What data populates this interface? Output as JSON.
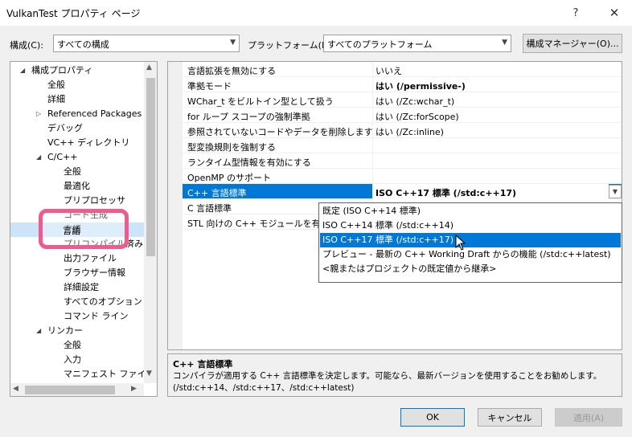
{
  "window": {
    "title": "VulkanTest プロパティ ページ",
    "help_glyph": "?",
    "close_glyph": "✕"
  },
  "config_bar": {
    "config_label": "構成(C):",
    "config_value": "すべての構成",
    "platform_label": "プラットフォーム(P):",
    "platform_value": "すべてのプラットフォーム",
    "manager_button": "構成マネージャー(O)..."
  },
  "tree": {
    "items": [
      {
        "label": "構成プロパティ",
        "expander": "◢"
      },
      {
        "label": "全般"
      },
      {
        "label": "詳細"
      },
      {
        "label": "Referenced Packages",
        "expander": "▷"
      },
      {
        "label": "デバッグ"
      },
      {
        "label": "VC++ ディレクトリ"
      },
      {
        "label": "C/C++",
        "expander": "◢"
      },
      {
        "label": "全般"
      },
      {
        "label": "最適化"
      },
      {
        "label": "プリプロセッサ"
      },
      {
        "label": "コード生成"
      },
      {
        "label": "言語"
      },
      {
        "label": "プリコンパイル済みヘッダー"
      },
      {
        "label": "出力ファイル"
      },
      {
        "label": "ブラウザー情報"
      },
      {
        "label": "詳細設定"
      },
      {
        "label": "すべてのオプション"
      },
      {
        "label": "コマンド ライン"
      },
      {
        "label": "リンカー",
        "expander": "◢"
      },
      {
        "label": "全般"
      },
      {
        "label": "入力"
      },
      {
        "label": "マニフェスト ファイル"
      }
    ],
    "selected_label": "言語",
    "highlight_color": "#f05a8c"
  },
  "grid": {
    "rows": [
      {
        "name": "言語拡張を無効にする",
        "value": "いいえ"
      },
      {
        "name": "準拠モード",
        "value": "はい (/permissive-)"
      },
      {
        "name": "WChar_t をビルトイン型として扱う",
        "value": "はい (/Zc:wchar_t)"
      },
      {
        "name": "for ループ スコープの強制準拠",
        "value": "はい (/Zc:forScope)"
      },
      {
        "name": "参照されていないコードやデータを削除します",
        "value": "はい (/Zc:inline)"
      },
      {
        "name": "型変換規則を強制する",
        "value": ""
      },
      {
        "name": "ランタイム型情報を有効にする",
        "value": ""
      },
      {
        "name": "OpenMP のサポート",
        "value": ""
      },
      {
        "name": "C++ 言語標準",
        "value": "ISO C++17 標準 (/std:c++17)"
      },
      {
        "name": "C 言語標準",
        "value": ""
      },
      {
        "name": "STL 向けの C++ モジュールを有効",
        "value": ""
      }
    ],
    "selected_index": 8
  },
  "dropdown": {
    "options": [
      "既定 (ISO C++14 標準)",
      "ISO C++14 標準 (/std:c++14)",
      "ISO C++17 標準 (/std:c++17)",
      "プレビュー - 最新の C++ Working Draft からの機能 (/std:c++latest)",
      "<親またはプロジェクトの既定値から継承>"
    ],
    "selected_index": 2
  },
  "description": {
    "title": "C++ 言語標準",
    "text": "コンパイラが適用する C++ 言語標準を決定します。可能なら、最新バージョンを使用することをお勧めします。 (/std:c++14、/std:c++17、/std:c++latest)"
  },
  "buttons": {
    "ok": "OK",
    "cancel": "キャンセル",
    "apply": "適用(A)"
  },
  "colors": {
    "accent": "#0078d7",
    "selection_light": "#cce4f7"
  }
}
